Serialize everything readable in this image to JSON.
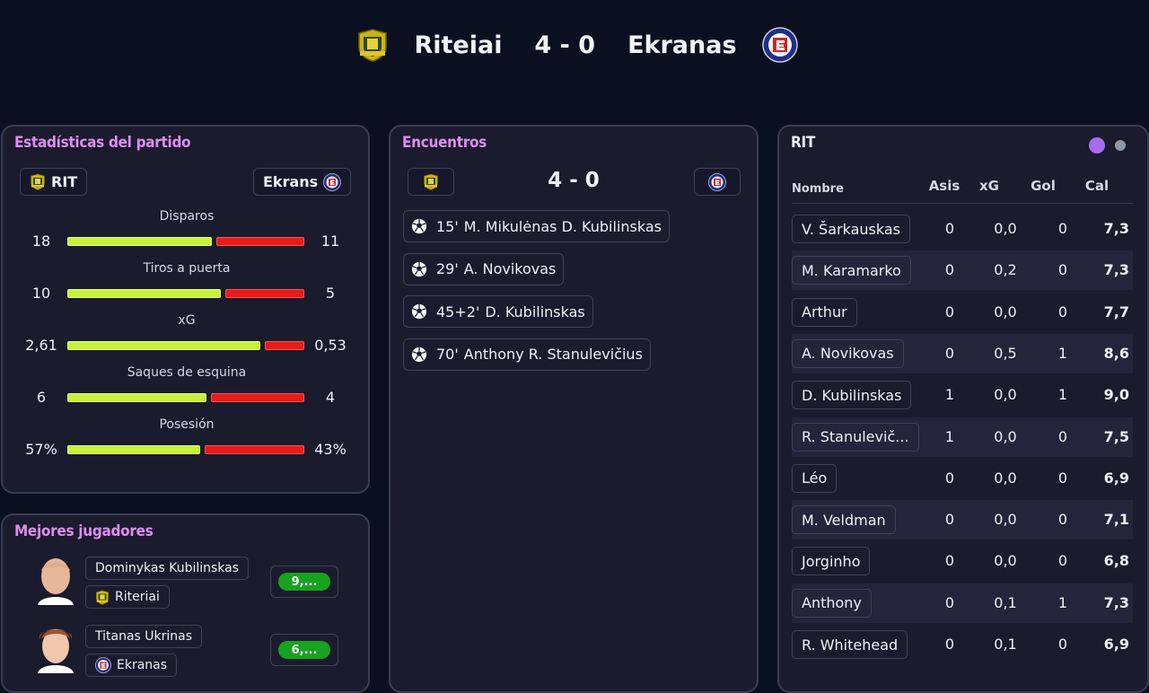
{
  "header": {
    "home_team": "Riteiai",
    "score": "4 - 0",
    "away_team": "Ekranas",
    "home_crest_icon": "riteriai-crest-icon",
    "away_crest_icon": "ekranas-crest-icon"
  },
  "stats_panel": {
    "title": "Estadísticas del partido",
    "home_abbr": "RIT",
    "away_abbr": "Ekrans",
    "colors": {
      "home_bar": "#c8f03c",
      "away_bar": "#e61c1c"
    },
    "stats": [
      {
        "label": "Disparos",
        "home": "18",
        "away": "11",
        "home_share": 0.62
      },
      {
        "label": "Tiros a puerta",
        "home": "10",
        "away": "5",
        "home_share": 0.66
      },
      {
        "label": "xG",
        "home": "2,61",
        "away": "0,53",
        "home_share": 0.83
      },
      {
        "label": "Saques de esquina",
        "home": "6",
        "away": "4",
        "home_share": 0.6
      },
      {
        "label": "Posesión",
        "home": "57%",
        "away": "43%",
        "home_share": 0.57
      }
    ]
  },
  "best_players": {
    "title": "Mejores jugadores",
    "players": [
      {
        "name": "Dominykas Kubilinskas",
        "team": "Riteriai",
        "rating": "9,..."
      },
      {
        "name": "Titanas Ukrinas",
        "team": "Ekranas",
        "rating": "6,..."
      }
    ]
  },
  "events_panel": {
    "title": "Encuentros",
    "score": "4 - 0",
    "events": [
      {
        "minute": "15'",
        "text": "M. Mikulėnas D. Kubilinskas",
        "icon": "soccer-ball-icon"
      },
      {
        "minute": "29'",
        "text": "A. Novikovas",
        "icon": "soccer-ball-icon"
      },
      {
        "minute": "45+2'",
        "text": "D. Kubilinskas",
        "icon": "soccer-ball-icon"
      },
      {
        "minute": "70'",
        "text": "Anthony R. Stanulevičius",
        "icon": "soccer-ball-icon"
      }
    ]
  },
  "players_panel": {
    "title": "RIT",
    "dot_colors": [
      "#a66cf0",
      "#8f99a3"
    ],
    "columns": [
      "Nombre",
      "Asis",
      "xG",
      "Gol",
      "Cal"
    ],
    "rows": [
      {
        "name": "V. Šarkauskas",
        "asis": "0",
        "xg": "0,0",
        "gol": "0",
        "cal": "7,3"
      },
      {
        "name": "M. Karamarko",
        "asis": "0",
        "xg": "0,2",
        "gol": "0",
        "cal": "7,3"
      },
      {
        "name": "Arthur",
        "asis": "0",
        "xg": "0,0",
        "gol": "0",
        "cal": "7,7"
      },
      {
        "name": "A. Novikovas",
        "asis": "0",
        "xg": "0,5",
        "gol": "1",
        "cal": "8,6"
      },
      {
        "name": "D. Kubilinskas",
        "asis": "1",
        "xg": "0,0",
        "gol": "1",
        "cal": "9,0"
      },
      {
        "name": "R. Stanulevič...",
        "asis": "1",
        "xg": "0,0",
        "gol": "0",
        "cal": "7,5"
      },
      {
        "name": "Léo",
        "asis": "0",
        "xg": "0,0",
        "gol": "0",
        "cal": "6,9"
      },
      {
        "name": "M. Veldman",
        "asis": "0",
        "xg": "0,0",
        "gol": "0",
        "cal": "7,1"
      },
      {
        "name": "Jorginho",
        "asis": "0",
        "xg": "0,0",
        "gol": "0",
        "cal": "6,8"
      },
      {
        "name": "Anthony",
        "asis": "0",
        "xg": "0,1",
        "gol": "1",
        "cal": "7,3"
      },
      {
        "name": "R. Whitehead",
        "asis": "0",
        "xg": "0,1",
        "gol": "0",
        "cal": "6,9"
      }
    ]
  }
}
